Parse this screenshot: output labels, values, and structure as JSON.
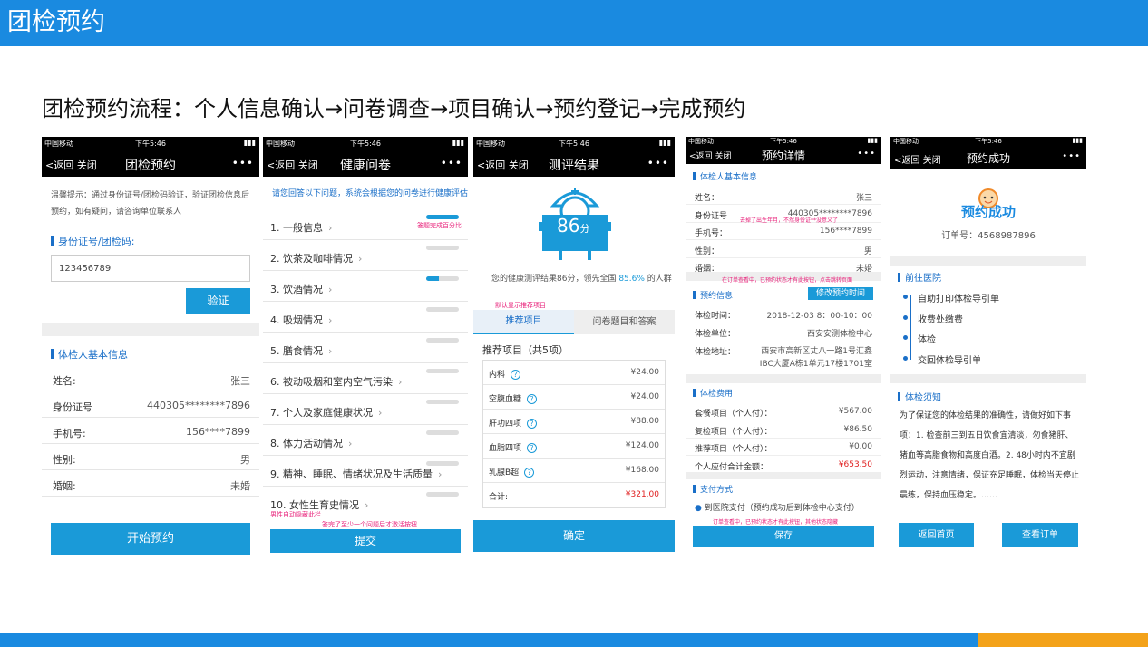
{
  "page_title": "团检预约",
  "subtitle": "团检预约流程：个人信息确认→问卷调查→项目确认→预约登记→完成预约",
  "status": {
    "carrier": "中国移动",
    "time": "下午5:46"
  },
  "nav": {
    "back": "返回",
    "close": "关闭",
    "more": "•••"
  },
  "phone1": {
    "title": "团检预约",
    "tip": "温馨提示：通过身份证号/团检码验证，验证团检信息后预约，如有疑问，请咨询单位联系人",
    "id_label": "身份证号/团检码:",
    "id_value": "123456789",
    "verify": "验证",
    "info_header": "体检人基本信息",
    "rows": [
      {
        "k": "姓名:",
        "v": "张三"
      },
      {
        "k": "身份证号",
        "v": "440305********7896"
      },
      {
        "k": "手机号:",
        "v": "156****7899"
      },
      {
        "k": "性别:",
        "v": "男"
      },
      {
        "k": "婚姻:",
        "v": "未婚"
      }
    ],
    "start": "开始预约"
  },
  "phone2": {
    "title": "健康问卷",
    "intro": "请您回答以下问题，系统会根据您的问卷进行健康评估",
    "progress_note": "答题完成百分比",
    "items": [
      {
        "label": "1. 一般信息",
        "pct": 100
      },
      {
        "label": "2. 饮茶及咖啡情况",
        "pct": 0
      },
      {
        "label": "3. 饮酒情况",
        "pct": 40
      },
      {
        "label": "4. 吸烟情况",
        "pct": 0
      },
      {
        "label": "5. 膳食情况",
        "pct": 0
      },
      {
        "label": "6. 被动吸烟和室内空气污染",
        "pct": 0
      },
      {
        "label": "7. 个人及家庭健康状况",
        "pct": 0
      },
      {
        "label": "8. 体力活动情况",
        "pct": 0
      },
      {
        "label": "9. 精神、睡眠、情绪状况及生活质量",
        "pct": 0
      },
      {
        "label": "10. 女性生育史情况",
        "pct": 0
      }
    ],
    "note_hidden": "男性自动隐藏此栏",
    "note_submit": "答完了至少一个问题后才激活按钮",
    "submit": "提交"
  },
  "phone3": {
    "title": "测评结果",
    "score_num": "86",
    "score_unit": "分",
    "result_pre": "您的健康测评结果86分，领先全国",
    "result_pct": "85.6%",
    "result_post": "的人群",
    "note_default": "默认显示推荐项目",
    "tab1": "推荐项目",
    "tab2": "问卷题目和答案",
    "rec_title": "推荐项目（共5项）",
    "items": [
      {
        "name": "内科",
        "price": "¥24.00"
      },
      {
        "name": "空腹血糖",
        "price": "¥24.00"
      },
      {
        "name": "肝功四项",
        "price": "¥88.00"
      },
      {
        "name": "血脂四项",
        "price": "¥124.00"
      },
      {
        "name": "乳腺B超",
        "price": "¥168.00"
      }
    ],
    "total_label": "合计:",
    "total": "¥321.00",
    "confirm": "确定"
  },
  "phone4": {
    "title": "预约详情",
    "info_header": "体检人基本信息",
    "rows": [
      {
        "k": "姓名：",
        "v": "张三"
      },
      {
        "k": "身份证号",
        "v": "440305********7896"
      },
      {
        "k": "手机号：",
        "v": "156****7899"
      },
      {
        "k": "性别：",
        "v": "男"
      },
      {
        "k": "婚姻：",
        "v": "未婚"
      }
    ],
    "note_id": "去掉了出生年月，不然身份证**没意义了",
    "note_order": "在订单查看中，已预约状态才有此按钮，点击跳转页面",
    "appt_header": "预约信息",
    "modify": "修改预约时间",
    "appt_rows": [
      {
        "k": "体检时间：",
        "v": "2018-12-03 8：00-10：00"
      },
      {
        "k": "体检单位：",
        "v": "西安安测体检中心"
      },
      {
        "k": "体检地址：",
        "v": "西安市高新区丈八一路1号汇鑫IBC大厦A栋1单元17楼1701室"
      }
    ],
    "fee_header": "体检费用",
    "fees": [
      {
        "k": "套餐项目（个人付）：",
        "v": "¥567.00"
      },
      {
        "k": "复检项目（个人付）：",
        "v": "¥86.50"
      },
      {
        "k": "推荐项目（个人付）：",
        "v": "¥0.00"
      },
      {
        "k": "个人应付合计金额：",
        "v": "¥653.50"
      }
    ],
    "pay_header": "支付方式",
    "pay_option": "到医院支付（预约成功后到体检中心支付）",
    "note_pay": "订单查看中，已预约状态才有此按钮，其他状态隐藏",
    "save": "保存"
  },
  "phone5": {
    "title": "预约成功",
    "success": "预约成功",
    "order": "订单号：4568987896",
    "hosp_header": "前往医院",
    "steps": [
      "自助打印体检导引单",
      "收费处缴费",
      "体检",
      "交回体检导引单"
    ],
    "notice_header": "体检须知",
    "notice": "为了保证您的体检结果的准确性，请做好如下事项：1. 检查前三到五日饮食宜清淡，勿食猪肝、猪血等高脂食物和高度白酒。2. 48小时内不宜剧烈运动，注意情绪，保证充足睡眠，体检当天停止晨练，保持血压稳定。……",
    "home": "返回首页",
    "view": "查看订单"
  }
}
